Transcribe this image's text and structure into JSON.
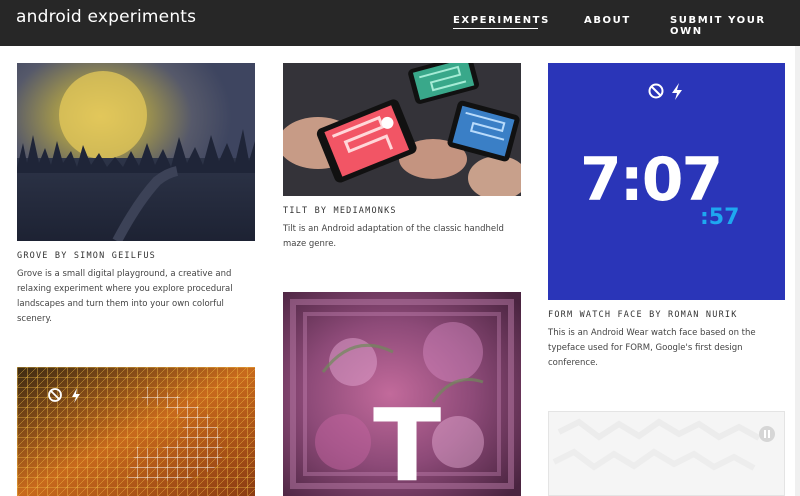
{
  "header": {
    "logo": "android experiments",
    "nav": [
      {
        "label": "EXPERIMENTS",
        "active": true
      },
      {
        "label": "ABOUT",
        "active": false
      },
      {
        "label": "SUBMIT YOUR OWN",
        "active": false
      }
    ]
  },
  "cards": [
    {
      "title": "GROVE BY SIMON GEILFUS",
      "description": "Grove is a small digital playground, a creative and relaxing experiment where you explore procedural landscapes and turn them into your own colorful scenery."
    },
    {
      "title": "TILT BY MEDIAMONKS",
      "description": "Tilt is an Android adaptation of the classic handheld maze genre."
    },
    {
      "title": "FORM WATCH FACE BY ROMAN NURIK",
      "description": "This is an Android Wear watch face based on the typeface used for FORM, Google's first design conference.",
      "watch_time": "7:07",
      "watch_seconds": ":57"
    },
    {
      "title": "",
      "description": ""
    },
    {
      "title": "",
      "description": "",
      "letter": "T"
    },
    {
      "title": "",
      "description": ""
    }
  ],
  "colors": {
    "header_bg": "#272727",
    "form_blue": "#2a35b8",
    "form_cyan": "#1ea8f0"
  }
}
